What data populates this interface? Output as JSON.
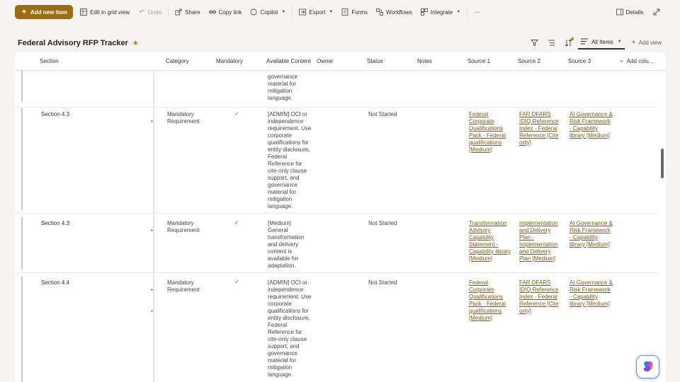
{
  "toolbar": {
    "new_item": "Add new item",
    "edit_grid": "Edit in grid view",
    "undo": "Undo",
    "share": "Share",
    "copy_link": "Copy link",
    "copilot": "Copilot",
    "export": "Export",
    "forms": "Forms",
    "workflows": "Workflows",
    "integrate": "Integrate",
    "more": "···",
    "details": "Details",
    "accent": "#9a6d12"
  },
  "page": {
    "title": "Federal Advisory RFP Tracker"
  },
  "view": {
    "current": "All Items",
    "add_view": "Add view"
  },
  "columns": {
    "section": "Section",
    "category": "Category",
    "mandatory": "Mandatory",
    "available_content": "Available Content",
    "owner": "Owner",
    "status": "Status",
    "notes": "Notes",
    "source1": "Source 1",
    "source2": "Source 2",
    "source3": "Source 3",
    "add_column": "Add colu..."
  },
  "rows": [
    {
      "section": "",
      "category": "",
      "mandatory": false,
      "available_content": "governance material for mitigation language.",
      "status": "",
      "source1": "",
      "source2": "",
      "source3": ""
    },
    {
      "section": "Section 4.3",
      "category": "Mandatory Requirement",
      "mandatory": true,
      "available_content": "[ADMIN] OCI or independence requirement. Use corporate qualifications for entity disclosure, Federal Reference for cite-only clause support, and governance material for mitigation language.",
      "status": "Not Started",
      "source1": "Federal Corporate Qualifications Pack - Federal qualifications [Medium]",
      "source2": "FAR DFARS IDIQ Reference Index - Federal Reference [Cite only]",
      "source3": "AI Governance & Risk Framework - Capability library [Medium]"
    },
    {
      "section": "Section 4.3",
      "category": "Mandatory Requirement",
      "mandatory": true,
      "available_content": "[Medium] General transformation and delivery content is available for adaptation.",
      "status": "Not Started",
      "source1": "Transformation Advisory Capability Statement - Capability library [Medium]",
      "source2": "Implementation and Delivery Plan - Implementation and Delivery Plan [Medium]",
      "source3": "AI Governance & Risk Framework - Capability library [Medium]"
    },
    {
      "section": "Section 4.4",
      "category": "Mandatory Requirement",
      "mandatory": true,
      "available_content": "[ADMIN] OCI or independence requirement. Use corporate qualifications for entity disclosure, Federal Reference for cite-only clause support, and governance material for mitigation language.",
      "status": "Not Started",
      "source1": "Federal Corporate Qualifications Pack - Federal qualifications [Medium]",
      "source2": "FAR DFARS IDIQ Reference Index - Federal Reference [Cite only]",
      "source3": "AI Governance & Risk Framework - Capability library [Medium]"
    }
  ],
  "row_marks": [
    "✓"
  ],
  "stray_glyphs": [
    "▪",
    "▪",
    "▪",
    "▪",
    "▪"
  ]
}
